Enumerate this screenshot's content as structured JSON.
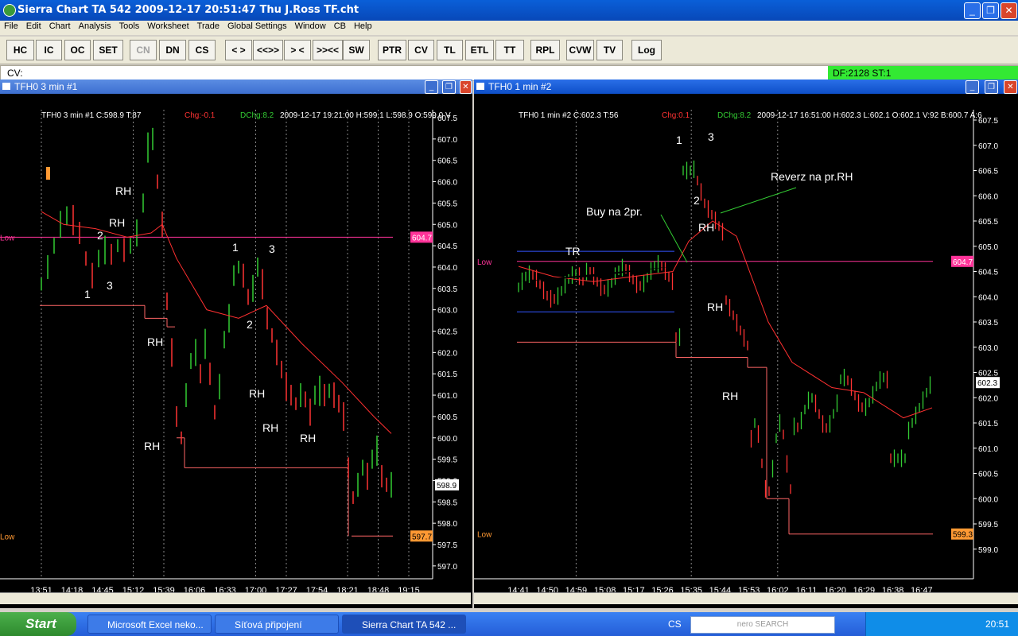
{
  "app": {
    "title": "Sierra Chart TA 542  2009-12-17  20:51:47  Thu   J.Ross TF.cht",
    "window_buttons": [
      "_",
      "❐",
      "✕"
    ]
  },
  "menu": [
    "File",
    "Edit",
    "Chart",
    "Analysis",
    "Tools",
    "Worksheet",
    "Trade",
    "Global Settings",
    "Window",
    "CB",
    "Help"
  ],
  "toolbar": [
    "HC",
    "IC",
    "OC",
    "SET",
    "CN",
    "DN",
    "CS",
    "< >",
    "<<>>",
    "> <",
    ">><<",
    "SW",
    "PTR",
    "CV",
    "TL",
    "ETL",
    "TT",
    "RPL",
    "CVW",
    "TV",
    "Log"
  ],
  "toolbar_disabled": [
    "CN"
  ],
  "cvbar": {
    "label": "CV:",
    "df_status": "DF:2128   ST:1"
  },
  "colors": {
    "up_bar": "#33cc33",
    "down_bar": "#ff3333",
    "ma_line": "#ff3030",
    "low_line": "#ff3399",
    "level_line": "#ff6666",
    "tr_line": "#3355ff",
    "status_green": "#33e933"
  },
  "chart1": {
    "title": "TFH0  3 min   #1",
    "status": {
      "main": "TFH0  3 min   #1  C:598.9  T:87",
      "chg": "Chg:-0.1",
      "dchg": "DChg:8.2",
      "rest": "2009-12-17   19:21:00  H:599.1   L:598.9   O:599.0   V"
    },
    "price_axis": [
      "607.5",
      "607.0",
      "606.5",
      "606.0",
      "605.5",
      "605.0",
      "604.5",
      "604.0",
      "603.5",
      "603.0",
      "602.5",
      "602.0",
      "601.5",
      "601.0",
      "600.5",
      "600.0",
      "599.5",
      "599.0",
      "598.5",
      "598.0",
      "597.5",
      "597.0"
    ],
    "time_axis": [
      "13:51",
      "14:18",
      "14:45",
      "15:12",
      "15:39",
      "16:06",
      "16:33",
      "17:00",
      "17:27",
      "17:54",
      "18:21",
      "18:48",
      "19:15"
    ],
    "tags": {
      "low_top": "604.7",
      "current": "598.9",
      "low_bottom": "597.7"
    },
    "low_label": "Low",
    "annotations": [
      "RH",
      "RH",
      "2",
      "1",
      "3",
      "RH",
      "RH",
      "1",
      "3",
      "2",
      "RH",
      "RH",
      "RH"
    ]
  },
  "chart2": {
    "title": "TFH0  1 min   #2",
    "status": {
      "main": "TFH0  1 min   #2  C:602.3  T:56",
      "chg": "Chg:0.1",
      "dchg": "DChg:8.2",
      "rest": "2009-12-17   16:51:00  H:602.3   L:602.1   O:602.1   V:92   B:600.7   A:6"
    },
    "price_axis": [
      "607.5",
      "607.0",
      "606.5",
      "606.0",
      "605.5",
      "605.0",
      "604.5",
      "604.0",
      "603.5",
      "603.0",
      "602.5",
      "602.0",
      "601.5",
      "601.0",
      "600.5",
      "600.0",
      "599.5",
      "599.0"
    ],
    "time_axis": [
      "14:41",
      "14:50",
      "14:59",
      "15:08",
      "15:17",
      "15:26",
      "15:35",
      "15:44",
      "15:53",
      "16:02",
      "16:11",
      "16:20",
      "16:29",
      "16:38",
      "16:47"
    ],
    "tags": {
      "low_top": "604.7",
      "current": "602.3",
      "low_bottom": "599.3"
    },
    "low_label": "Low",
    "annotations": [
      "TR",
      "Buy na 2pr.",
      "1",
      "3",
      "2",
      "Reverz na pr.RH",
      "RH",
      "RH",
      "RH"
    ]
  },
  "taskbar": {
    "start": "Start",
    "tasks": [
      "Microsoft Excel neko...",
      "Síťová připojení",
      "Sierra Chart TA 542 ..."
    ],
    "lang": "CS",
    "search": "nero SEARCH",
    "clock": "20:51"
  }
}
